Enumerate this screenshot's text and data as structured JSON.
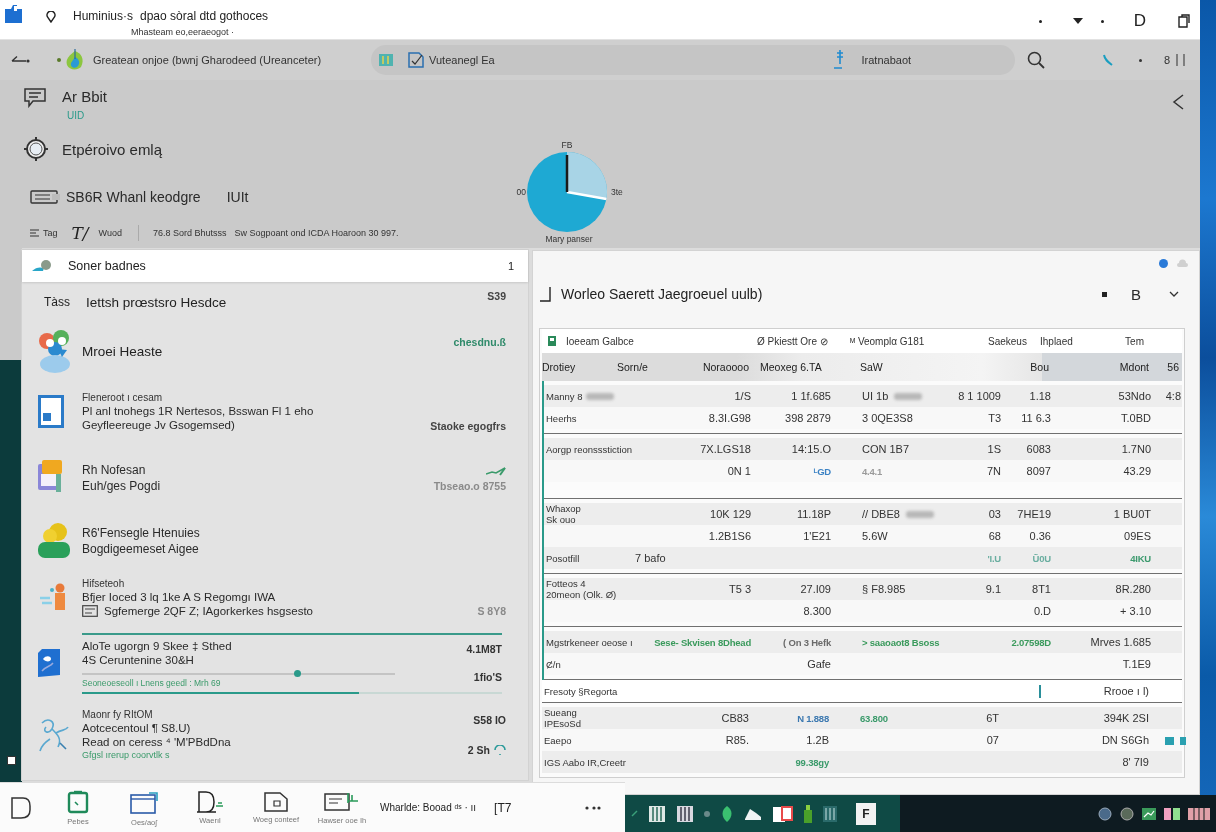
{
  "window": {
    "app_name": "Huminius·s",
    "title": "dpao sòral dtd gothoces",
    "subtitle": "Mhasteam eo,eeraeogot ·",
    "control_label": "D"
  },
  "toolbar": {
    "breadcrumb": "Greatean onjoe (bwnj Gharodeed (Ureanceter)",
    "search_value": "Vuteanegl Ea",
    "search_scope": "Iratnabaot",
    "counter": "8"
  },
  "overview": {
    "items": [
      {
        "kind": "message",
        "title": "Ar Bbit",
        "subtitle": "UID"
      },
      {
        "kind": "gear",
        "title": "Etpéroivo emlą"
      },
      {
        "kind": "tape",
        "title": "SB6R Whanl keodgre",
        "suffix": "IUIt"
      }
    ],
    "summary": {
      "tag": "Tag",
      "glyph": "T/",
      "label": "Wuod",
      "stat": "76.8 Sord Bhutsss",
      "note": "Sw Sogpoant ond ICDA Hoaroon 30 997."
    },
    "pie": {
      "top_label": "FB",
      "left_label": "00",
      "right_label": "3te",
      "caption": "Mary panser"
    }
  },
  "left_panel": {
    "title": "Soner badnes",
    "count": "1",
    "rows": [
      {
        "kind": "plain",
        "tag": "Tàss",
        "title": "Iettsh prœstsro Hesdce",
        "meta": [
          {
            "text": "S39",
            "color": "#444444"
          }
        ]
      },
      {
        "kind": "people",
        "title": "Mroei Heaste",
        "meta": [
          {
            "text": "chesdnu.ß",
            "color": "#2f8a6a"
          }
        ]
      },
      {
        "kind": "document",
        "overline": "Fleneroot ı cesam",
        "lines": [
          "Pl anl tnohegs 1R Nertesos, Bsswan Fl 1 eho",
          "Geyfleereuge Jv Gsogemsed)"
        ],
        "meta": [
          {
            "text": "Staoke egogfrs",
            "color": "#444444"
          }
        ]
      },
      {
        "kind": "notebook",
        "lines": [
          "Rh Nofesan",
          "Euh/ges Pogdi"
        ],
        "meta": [
          {
            "text": "Tbseao.o 8755",
            "color": "#8a8a8a"
          }
        ]
      },
      {
        "kind": "person",
        "lines": [
          "R6'Fensegle Htenuies",
          "Bogdigeemeset Aigee"
        ]
      },
      {
        "kind": "figure",
        "overline": "Hifseteoh",
        "lines": [
          "Bfjer Ioced 3 lq 1ke A S Regomgı IWA",
          "Sgfemerge 2QF Z; IAgorkerkes hsgsesto"
        ],
        "meta": [
          {
            "text": "S 8Y8",
            "color": "#8a8a8a"
          }
        ]
      },
      {
        "kind": "blue-doc",
        "lines": [
          "AloTe ugorgn 9 Skee ‡ Sthed",
          "4S Ceruntenine 30&H"
        ],
        "slider": {
          "level": 0.69,
          "caption": "Seoneoeseoll ı Lnens geedl : Mrh 69"
        },
        "progress": {
          "level": 0.66
        },
        "meta": [
          {
            "text": "4.1M8T",
            "color": "#333333"
          },
          {
            "text": "1fio'S",
            "color": "#333333"
          }
        ]
      },
      {
        "kind": "sketch",
        "overline": "Maonr fy RItOM",
        "lines": [
          "Aotcecentoul ¶ S8.U)",
          "Read on ceress ⁴ 'M'PBdDna"
        ],
        "note": "Gfgsl ırerup coorvtlk s",
        "meta": [
          {
            "text": "S58 IO",
            "color": "#333333"
          },
          {
            "text": "2 Sh",
            "color": "#333333"
          }
        ]
      }
    ]
  },
  "right_panel": {
    "title": "Worleo Saerett Jaegroeuel uulb)",
    "control_label": "B",
    "table": {
      "toolbar": [
        "Ioeeam Galbce",
        "Ø Pkiestt Ore ⊘",
        "ᴹ Veomplα G181",
        "Saekeus",
        "Ihplaed",
        "Tem"
      ],
      "columns": [
        "Drotiey",
        "Sorn/e",
        "Noraoooo",
        "Meoxeg 6.TA",
        "SaW",
        null,
        "Bou",
        "Mdont",
        "56"
      ],
      "groups": [
        {
          "rows": [
            {
              "label": "Manny 8",
              "label_bar": true,
              "cells": [
                null,
                "1/S",
                "1 1f.685",
                {
                  "text": "UI 1b",
                  "bar": true
                },
                "8 1 1009",
                "1.18",
                "53Ndo",
                "4:8"
              ]
            },
            {
              "label": "Heerhs",
              "cells": [
                null,
                "8.3I.G98",
                "398 2879",
                "3 0QE3S8",
                "T3",
                "11 6.3",
                "T.0BD",
                null
              ]
            }
          ]
        },
        {
          "rows": [
            {
              "label": "Aorgp reonssstiction",
              "cells": [
                null,
                "7X.LGS18",
                "14:15.O",
                "CON 1B7",
                "1S",
                "6083",
                "1.7N0",
                null
              ]
            },
            {
              "cells": [
                null,
                "0N 1",
                {
                  "text": "ᴸGD",
                  "color": "#3b82c4"
                },
                {
                  "text": "4.4.1",
                  "color": "#9a9a9a"
                },
                "7N",
                "8097",
                "43.29",
                null
              ]
            }
          ]
        },
        {
          "rows": [
            {
              "label": "Whaxop",
              "sublabel": "Sk ouo",
              "cells": [
                null,
                "10K 129",
                "11.18P",
                {
                  "text": "// DBE8",
                  "bar": true
                },
                "03",
                "7HE19",
                "1 BU0T",
                null
              ]
            },
            {
              "cells": [
                null,
                "1.2B1S6",
                "1'E21",
                "5.6W",
                "68",
                "0.36",
                "09ES",
                null
              ]
            },
            {
              "label": "Posotfill",
              "cells": [
                "7 bafo",
                null,
                null,
                null,
                {
                  "text": "'I.U",
                  "color": "#6aaea0"
                },
                {
                  "text": "Ũ0U",
                  "color": "#6aaea0"
                },
                {
                  "text": "4IKU",
                  "color": "#3d9a6e"
                },
                null
              ]
            }
          ]
        },
        {
          "rows": [
            {
              "label": "Fotteos 4",
              "sublabel": "20meon (Olk. Ø)",
              "cells": [
                null,
                "T5 3",
                "27.I09",
                "§ F8.985",
                "9.1",
                "8T1",
                "8R.280",
                null
              ]
            },
            {
              "cells": [
                null,
                null,
                "8.300",
                null,
                null,
                "0.D",
                "+ 3.10",
                null
              ]
            }
          ]
        },
        {
          "rows": [
            {
              "label": "Mgstrkeneer oeose ı",
              "cells": [
                null,
                {
                  "text": "Sese- Skvisen 8Dhead",
                  "color": "#3a9a5c"
                },
                {
                  "text": "( On 3 Hefk",
                  "color": "#6a6a6a"
                },
                {
                  "text": "> saaoaot8 Bsoss",
                  "color": "#3a9a5c"
                },
                null,
                {
                  "text": "2.07598D",
                  "color": "#3a9a5c"
                },
                "Mrves 1.685",
                null
              ]
            },
            {
              "label": "Ȼ/n",
              "cells": [
                null,
                null,
                "Gafe",
                null,
                null,
                null,
                "T.1E9",
                null
              ]
            }
          ]
        }
      ],
      "summary_row": {
        "label": "Fresoty §Regorta",
        "cells": [
          null,
          null,
          null,
          null,
          null,
          {
            "kind": "marker",
            "color": "#2a8f9a"
          },
          "Rrooe ı l)",
          null
        ]
      },
      "after_groups": [
        {
          "rows": [
            {
              "label": "Sueang",
              "sublabel": "IPEsoSd",
              "cells": [
                null,
                "CB83",
                {
                  "text": "N 1.888",
                  "color": "#3b78b0"
                },
                {
                  "text": "63.800",
                  "color": "#3a9a6a"
                },
                "6T",
                null,
                "394K 2SI",
                null
              ]
            },
            {
              "label": "Eaepo",
              "cells": [
                null,
                "R85.",
                "1.2B",
                null,
                "07",
                null,
                "DN S6Gh",
                null
              ]
            },
            {
              "label": "IGS Aabo IR,Creetr",
              "cells": [
                null,
                null,
                {
                  "text": "99.38gy",
                  "color": "#3a9a6a"
                },
                null,
                null,
                null,
                "8' 7I9",
                null
              ]
            }
          ]
        }
      ]
    }
  },
  "dock": {
    "labels": [
      "Pebes",
      "Oes/aoʃ",
      "Waerıl",
      "Woeg conteef",
      "Hawser ooe Ih"
    ],
    "status": "Wharlde: Booad ᵈˢ · ıı",
    "tag": "[T7"
  },
  "taskbar": {
    "tile_label": "F"
  }
}
